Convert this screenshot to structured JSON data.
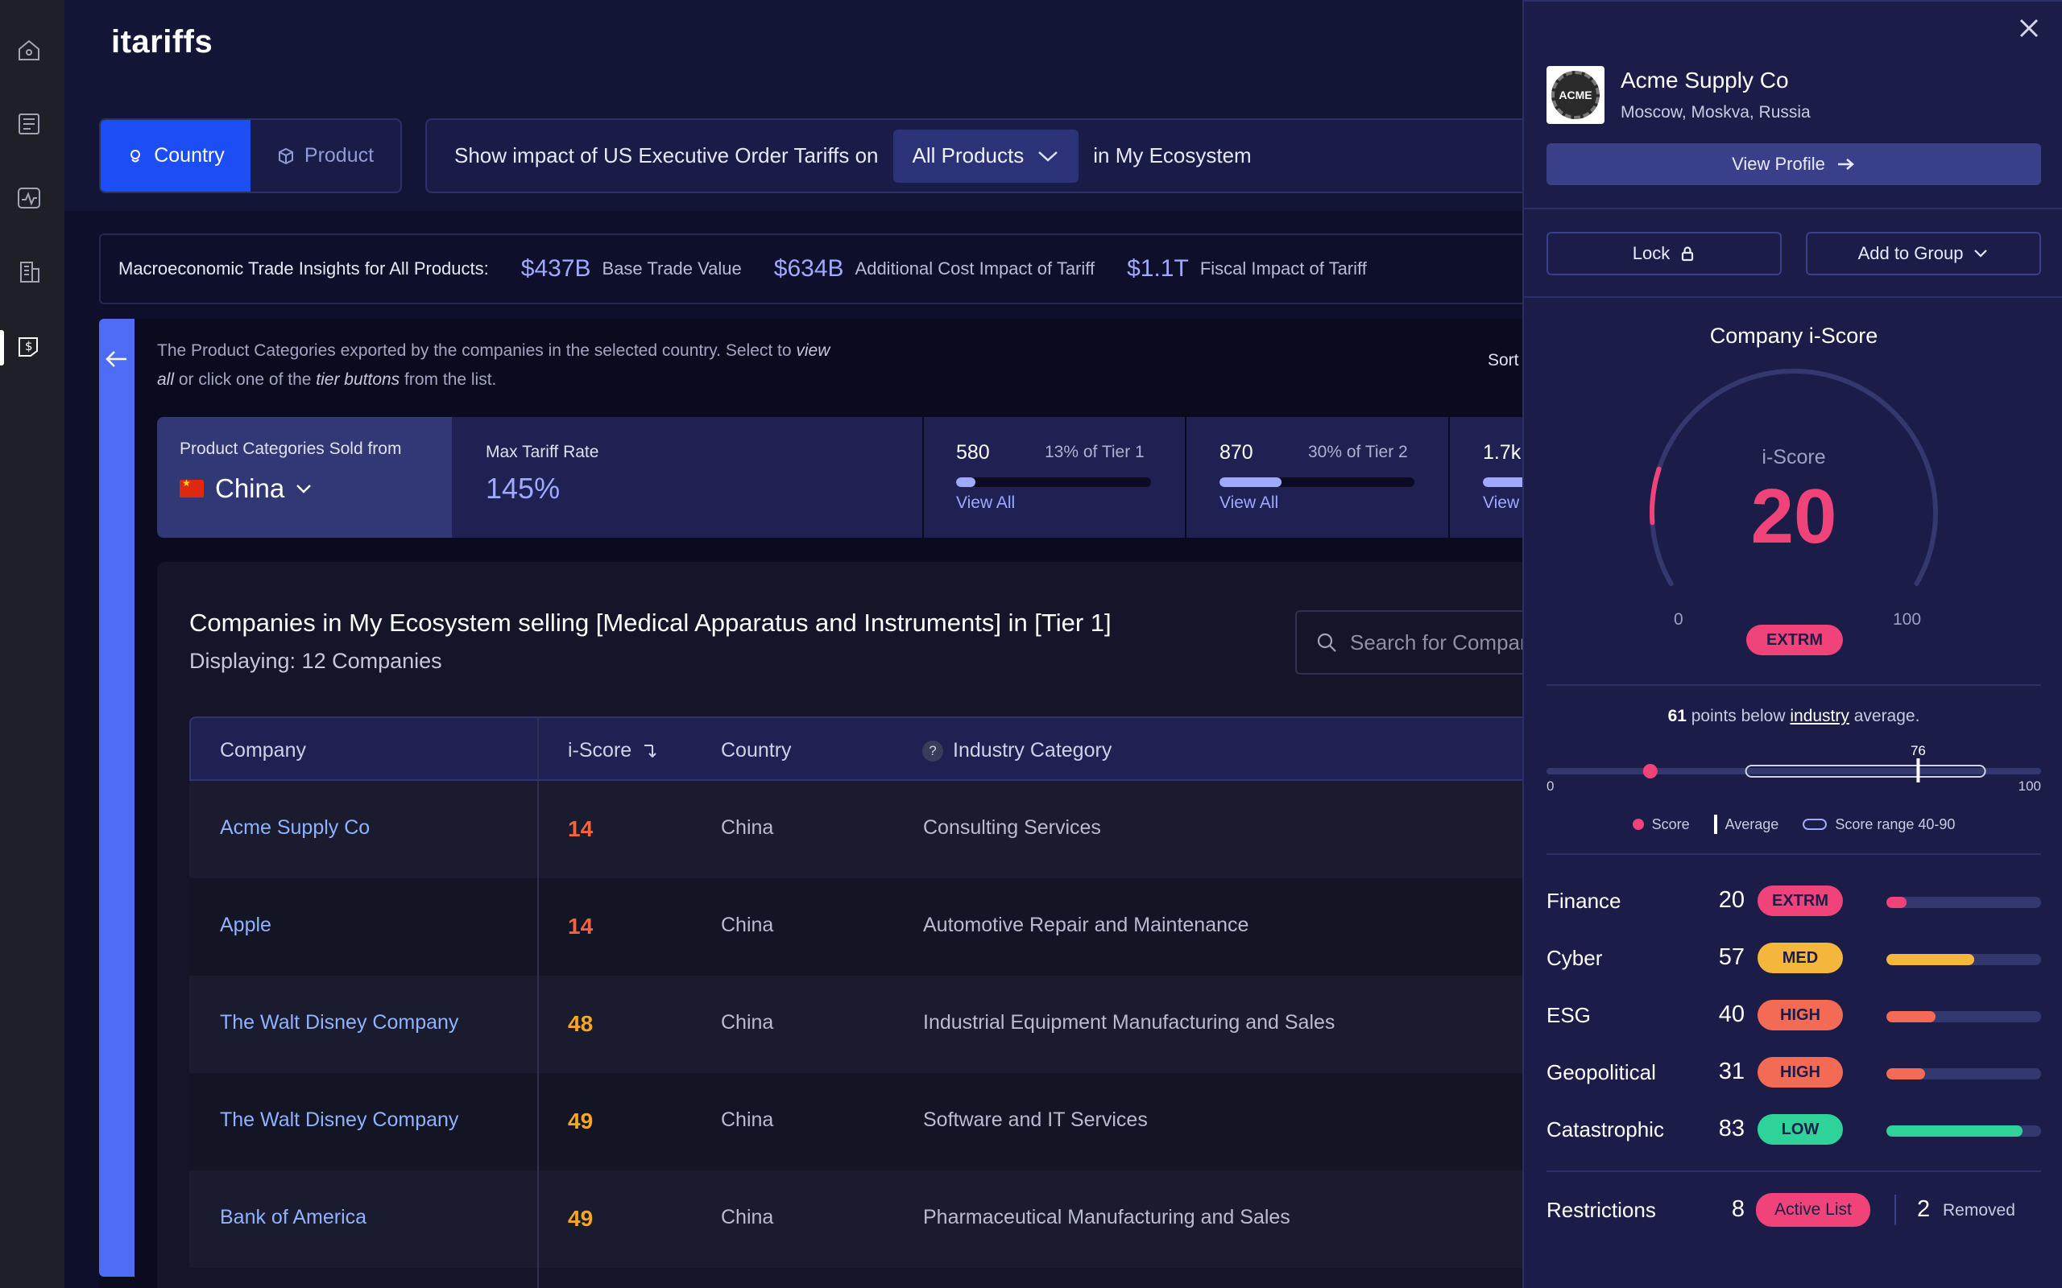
{
  "app": {
    "title": "itariffs"
  },
  "nav": {
    "items": [
      "home-icon",
      "newspaper-icon",
      "activity-icon",
      "buildings-icon",
      "tariff-icon"
    ]
  },
  "view_toggle": {
    "country_label": "Country",
    "product_label": "Product",
    "selected": "Country"
  },
  "impact": {
    "prefix": "Show impact of US Executive Order Tariffs on",
    "selected_product": "All Products",
    "suffix": "in My Ecosystem"
  },
  "macro": {
    "label": "Macroeconomic Trade Insights for All Products:",
    "stats": [
      {
        "value": "$437B",
        "label": "Base Trade Value"
      },
      {
        "value": "$634B",
        "label": "Additional Cost Impact of Tariff"
      },
      {
        "value": "$1.1T",
        "label": "Fiscal Impact of Tariff"
      }
    ]
  },
  "categories": {
    "desc_part1": "The Product Categories exported by the companies in the selected country. Select to ",
    "desc_view_all": "view all",
    "desc_part2": " or click one of the ",
    "desc_tier_buttons": "tier buttons",
    "desc_part3": " from the list.",
    "sort_label": "Sort",
    "sold_from_label": "Product Categories Sold from",
    "country": "China",
    "max_tariff_label": "Max Tariff Rate",
    "max_tariff_value": "145%",
    "tiers": [
      {
        "count": "580",
        "pct_label": "13% of Tier 1",
        "fill": 0.1,
        "view": "View All"
      },
      {
        "count": "870",
        "pct_label": "30% of Tier 2",
        "fill": 0.32,
        "view": "View All"
      },
      {
        "count": "1.7k",
        "pct_label": "",
        "fill": 0.5,
        "view": "View"
      }
    ]
  },
  "companies": {
    "title": "Companies in My Ecosystem selling [Medical Apparatus and Instruments] in [Tier 1]",
    "displaying": "Displaying: 12 Companies",
    "search_placeholder": "Search for Company",
    "columns": {
      "company": "Company",
      "iscore": "i-Score",
      "country": "Country",
      "industry": "Industry Category"
    },
    "rows": [
      {
        "company": "Acme Supply Co",
        "iscore": "14",
        "color": "#f0643e",
        "country": "China",
        "industry": "Consulting Services"
      },
      {
        "company": "Apple",
        "iscore": "14",
        "color": "#f0643e",
        "country": "China",
        "industry": "Automotive Repair and Maintenance"
      },
      {
        "company": "The Walt Disney Company",
        "iscore": "48",
        "color": "#f5a623",
        "country": "China",
        "industry": "Industrial Equipment Manufacturing and Sales"
      },
      {
        "company": "The Walt Disney Company",
        "iscore": "49",
        "color": "#f5a623",
        "country": "China",
        "industry": "Software and IT Services"
      },
      {
        "company": "Bank of America",
        "iscore": "49",
        "color": "#f5a623",
        "country": "China",
        "industry": "Pharmaceutical Manufacturing and Sales"
      }
    ]
  },
  "drawer": {
    "logo_text": "ACME",
    "company_name": "Acme Supply Co",
    "location": "Moscow, Moskva, Russia",
    "view_profile": "View Profile",
    "lock": "Lock",
    "add_to_group": "Add to Group",
    "score_title": "Company i-Score",
    "gauge_label": "i-Score",
    "score": 20,
    "score_display": "20",
    "gauge_min": "0",
    "gauge_max": "100",
    "score_badge": "EXTRM",
    "below_points": "61",
    "below_text1": " points below ",
    "below_industry": "industry",
    "below_text2": " average.",
    "range": {
      "min": "0",
      "max": "100",
      "avg": 76,
      "avg_label": "76",
      "score": 20,
      "range_low": 40,
      "range_high": 90
    },
    "legend": {
      "score": "Score",
      "average": "Average",
      "range": "Score range 40-90"
    },
    "metrics": [
      {
        "name": "Finance",
        "value": "20",
        "level": "EXTRM",
        "color": "#f0437a",
        "fill": 0.13
      },
      {
        "name": "Cyber",
        "value": "57",
        "level": "MED",
        "color": "#f5b73b",
        "fill": 0.57
      },
      {
        "name": "ESG",
        "value": "40",
        "level": "HIGH",
        "color": "#f36b55",
        "fill": 0.32
      },
      {
        "name": "Geopolitical",
        "value": "31",
        "level": "HIGH",
        "color": "#f36b55",
        "fill": 0.25
      },
      {
        "name": "Catastrophic",
        "value": "83",
        "level": "LOW",
        "color": "#2fd39a",
        "fill": 0.88
      }
    ],
    "restrictions": {
      "label": "Restrictions",
      "count": "8",
      "badge": "Active List",
      "removed_count": "2",
      "removed_label": "Removed"
    }
  }
}
